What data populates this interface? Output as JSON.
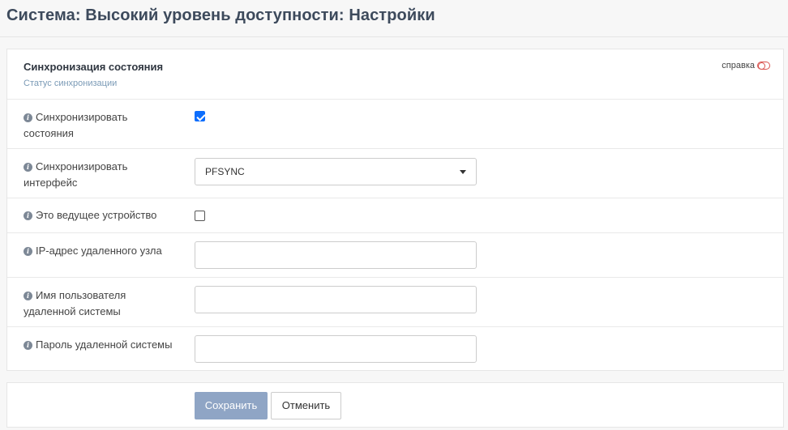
{
  "header": {
    "title": "Система: Высокий уровень доступности: Настройки"
  },
  "section": {
    "title": "Синхронизация состояния",
    "subtitle": "Статус синхронизации",
    "help_label": "справка"
  },
  "fields": {
    "sync_states": {
      "label": "Синхронизировать состояния",
      "checked": true
    },
    "sync_interface": {
      "label": "Синхронизировать интерфейс",
      "value": "PFSYNC"
    },
    "master_device": {
      "label": "Это ведущее устройство",
      "checked": false
    },
    "remote_ip": {
      "label": "IP-адрес удаленного узла",
      "value": ""
    },
    "remote_username": {
      "label": "Имя пользователя удаленной системы",
      "value": ""
    },
    "remote_password": {
      "label": "Пароль удаленной системы",
      "value": ""
    }
  },
  "actions": {
    "save_label": "Сохранить",
    "cancel_label": "Отменить"
  },
  "colors": {
    "accent": "#0d6efd",
    "save_button": "#8fa5c5",
    "help_toggle": "#d9534f"
  }
}
